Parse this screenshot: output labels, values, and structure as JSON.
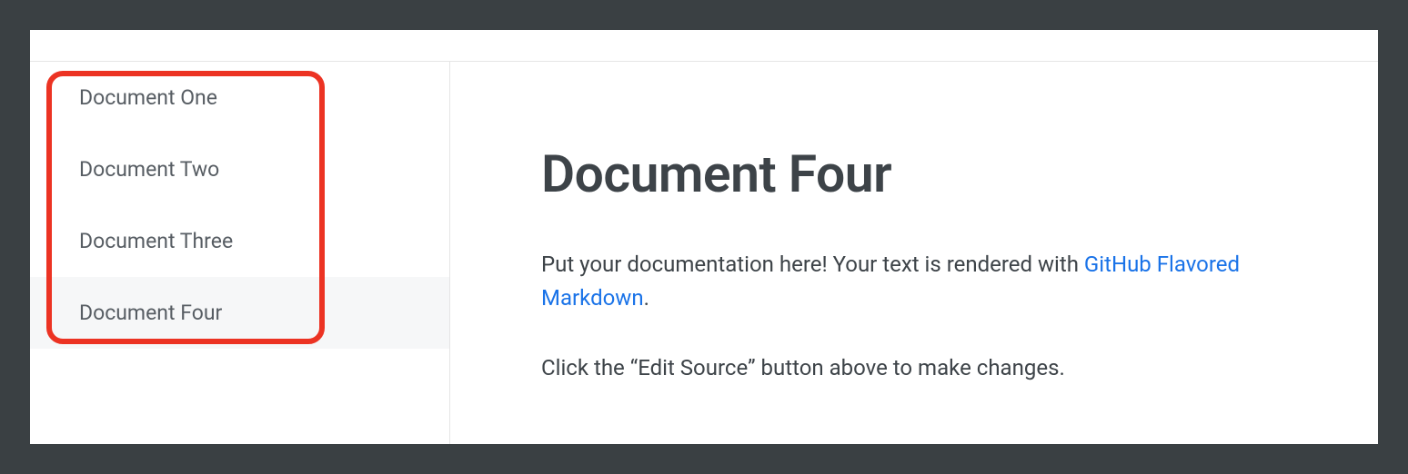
{
  "sidebar": {
    "items": [
      {
        "label": "Document One",
        "selected": false
      },
      {
        "label": "Document Two",
        "selected": false
      },
      {
        "label": "Document Three",
        "selected": false
      },
      {
        "label": "Document Four",
        "selected": true
      }
    ]
  },
  "main": {
    "title": "Document Four",
    "intro_prefix": "Put your documentation here! Your text is rendered with ",
    "intro_link": "GitHub Flavored Markdown",
    "intro_suffix": ".",
    "hint": "Click the “Edit Source” button above to make changes."
  }
}
